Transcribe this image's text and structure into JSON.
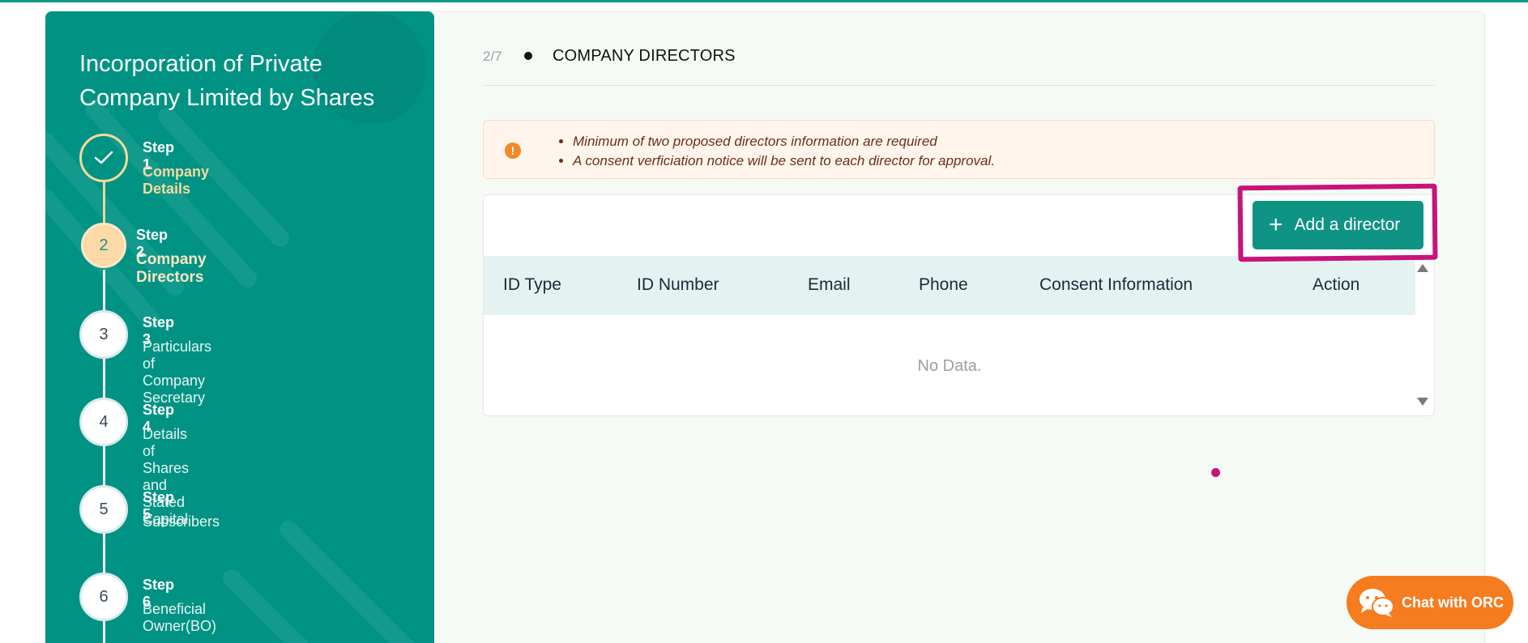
{
  "sidebar": {
    "title": "Incorporation of Private Company Limited by Shares",
    "steps": [
      {
        "num": "Step 1",
        "name": "Company Details",
        "badge": "",
        "state": "done"
      },
      {
        "num": "Step 2",
        "name": "Company Directors",
        "badge": "2",
        "state": "active"
      },
      {
        "num": "Step 3",
        "name": "Particulars of Company Secretary",
        "badge": "3",
        "state": "pending"
      },
      {
        "num": "Step 4",
        "name": "Details of Shares and Stated Capital",
        "badge": "4",
        "state": "pending"
      },
      {
        "num": "Step 5",
        "name": "Subscribers",
        "badge": "5",
        "state": "pending"
      },
      {
        "num": "Step 6",
        "name": "Beneficial Owner(BO)",
        "badge": "6",
        "state": "pending"
      }
    ]
  },
  "header": {
    "progress": "2/7",
    "title": "COMPANY DIRECTORS"
  },
  "notice": {
    "items": [
      "Minimum of two proposed directors information are required",
      "A consent verficiation notice will be sent to each director for approval."
    ]
  },
  "toolbar": {
    "add_label": "Add a director"
  },
  "table": {
    "columns": [
      "ID Type",
      "ID Number",
      "Email",
      "Phone",
      "Consent Information",
      "Action"
    ],
    "empty_text": "No Data."
  },
  "chat": {
    "label": "Chat with ORC"
  },
  "colors": {
    "brand": "#009384",
    "accent": "#f5d99f",
    "highlight": "#c8137c",
    "chat": "#f57c1f"
  }
}
